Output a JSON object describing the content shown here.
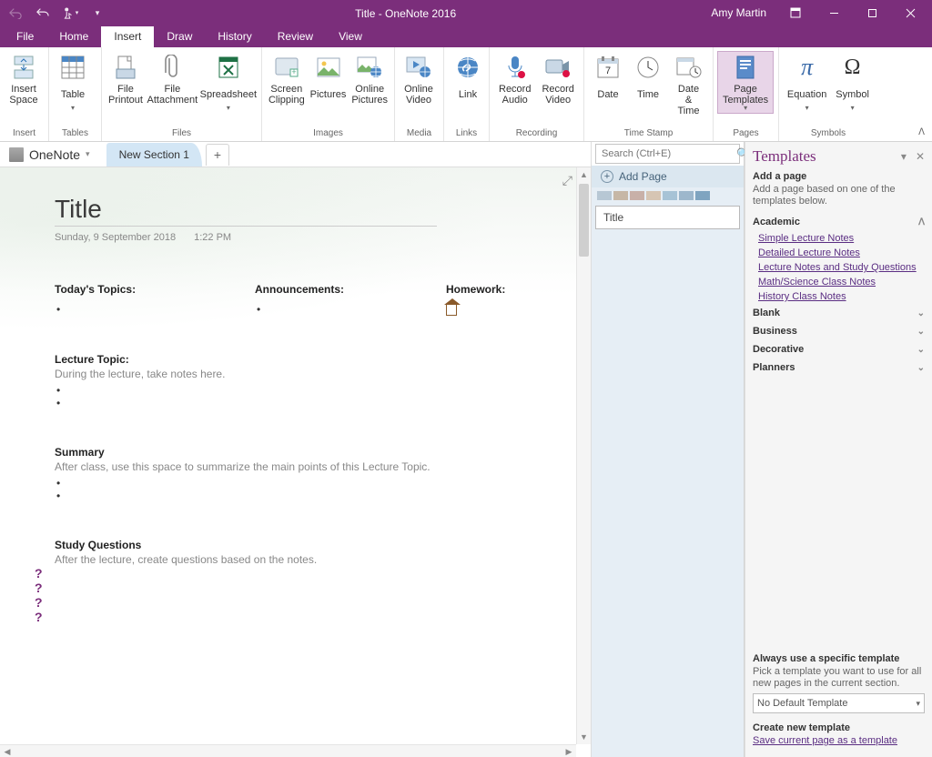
{
  "titlebar": {
    "center": "Title  -  OneNote 2016",
    "user": "Amy Martin"
  },
  "tabs": {
    "file": "File",
    "home": "Home",
    "insert": "Insert",
    "draw": "Draw",
    "history": "History",
    "review": "Review",
    "view": "View"
  },
  "ribbon": {
    "insert_space": "Insert\nSpace",
    "table": "Table",
    "file_printout": "File\nPrintout",
    "file_attachment": "File\nAttachment",
    "spreadsheet": "Spreadsheet",
    "screen_clipping": "Screen\nClipping",
    "pictures": "Pictures",
    "online_pictures": "Online\nPictures",
    "online_video": "Online\nVideo",
    "link": "Link",
    "record_audio": "Record\nAudio",
    "record_video": "Record\nVideo",
    "date": "Date",
    "time": "Time",
    "date_time": "Date &\nTime",
    "page_templates": "Page\nTemplates",
    "equation": "Equation",
    "symbol": "Symbol",
    "groups": {
      "insert": "Insert",
      "tables": "Tables",
      "files": "Files",
      "images": "Images",
      "media": "Media",
      "links": "Links",
      "recording": "Recording",
      "timestamp": "Time Stamp",
      "pages": "Pages",
      "symbols": "Symbols"
    }
  },
  "notebook": {
    "name": "OneNote",
    "section": "New Section 1"
  },
  "page": {
    "title": "Title",
    "date": "Sunday, 9 September 2018",
    "time": "1:22 PM",
    "topics_h": "Today's Topics:",
    "announce_h": "Announcements:",
    "homework_h": "Homework:",
    "lecture_h": "Lecture Topic:",
    "lecture_hint": "During the lecture, take notes here.",
    "summary_h": "Summary",
    "summary_hint": "After class, use this space to summarize the main points of this Lecture Topic.",
    "questions_h": "Study Questions",
    "questions_hint": "After the lecture, create questions based on the notes."
  },
  "search": {
    "placeholder": "Search (Ctrl+E)"
  },
  "pagespane": {
    "add": "Add Page",
    "item": "Title"
  },
  "templates": {
    "title": "Templates",
    "addpage": "Add a page",
    "addpage_desc": "Add a page based on one of the templates below.",
    "cat_academic": "Academic",
    "links": {
      "simple": "Simple Lecture Notes",
      "detailed": "Detailed Lecture Notes",
      "study": "Lecture Notes and Study Questions",
      "math": "Math/Science Class Notes",
      "history": "History Class Notes"
    },
    "cat_blank": "Blank",
    "cat_business": "Business",
    "cat_decorative": "Decorative",
    "cat_planners": "Planners",
    "always_h": "Always use a specific template",
    "always_desc": "Pick a template you want to use for all new pages in the current section.",
    "select": "No Default Template",
    "create_h": "Create new template",
    "create_link": "Save current page as a template"
  }
}
